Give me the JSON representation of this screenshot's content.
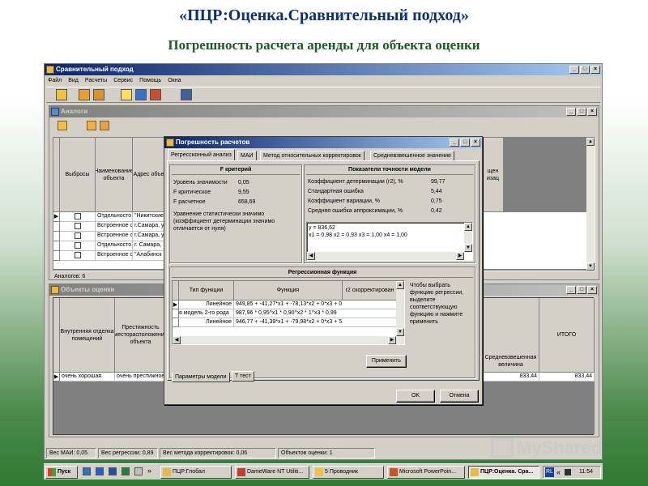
{
  "slide": {
    "title": "«ПЦР:Оценка.Сравнительный подход»",
    "subtitle": "Погрешность расчета аренды для объекта оценки"
  },
  "main_window": {
    "title": "Сравнительный подход",
    "menu": [
      "Файл",
      "Вид",
      "Расчеты",
      "Сервис",
      "Помощь",
      "Окна"
    ]
  },
  "analogs_window": {
    "title": "Аналоги",
    "columns": [
      "Выбросы",
      "Наименование объекта",
      "Адрес объекта"
    ],
    "right_col": "...щен\n...изац",
    "rows": [
      {
        "name": "Отдельносто",
        "addr": "\"Никитские"
      },
      {
        "name": "Встроенное с",
        "addr": "г.Самара, у"
      },
      {
        "name": "Встроенное с",
        "addr": "г.Самара, у"
      },
      {
        "name": "Отдельносто",
        "addr": "г. Самара,"
      },
      {
        "name": "Встроенное с",
        "addr": "\"Алабинск"
      }
    ],
    "status": "Аналогов: 6"
  },
  "objects_window": {
    "title": "Объекты оценки",
    "columns": [
      "Внутренняя отделка помещений",
      "Престижность месторасположения объекта"
    ],
    "right_cols": [
      "Средневзвешенная величина",
      "ИТОГО"
    ],
    "row": {
      "c1": "очень хорошая",
      "c2": "очень престижное",
      "v1": "833,44",
      "v2": "833,44"
    }
  },
  "dialog": {
    "title": "Погрешность расчетов",
    "tabs": [
      "Регрессионный анализ",
      "МАИ",
      "Метод относительных корректировок",
      "Средневзвешенное значение"
    ],
    "f_group": {
      "title": "F критерий",
      "rows": [
        {
          "label": "Уровень значимости",
          "value": "0,05"
        },
        {
          "label": "F критическое",
          "value": "9,55"
        },
        {
          "label": "F расчетное",
          "value": "658,69"
        }
      ],
      "note": "Уравнение статистически значимо (коэффициент детерминации значимо отличается от нуля)"
    },
    "accuracy_group": {
      "title": "Показатели точности модели",
      "rows": [
        {
          "label": "Коэффициент детерминации (r2), %",
          "value": "99,77"
        },
        {
          "label": "Стандартная ошибка",
          "value": "5,44"
        },
        {
          "label": "Коэффициент вариации, %",
          "value": "0,75"
        },
        {
          "label": "Средняя ошибка аппроксимации, %",
          "value": "0,42"
        }
      ],
      "text_line1": "у = 836,62",
      "text_line2": "x1 = 0,98  x2 = 0,93  x3 = 1,00  x4 = 1,00"
    },
    "regression": {
      "title": "Регрессионная функция",
      "columns": [
        "Тип функции",
        "Функция",
        "r2 скорректирован"
      ],
      "rows": [
        {
          "type": "Линейное",
          "func": "949,85 + -41,27*x1 + -78,13*x2 + 0*x3 + 0"
        },
        {
          "type": "я модель 2-го рода",
          "func": "987,96 * 0,95^x1 * 0,90^x2 * 1^x3 * 0,99"
        },
        {
          "type": "Линейное",
          "func": "946,77 + -41,39*x1 + -79,98*x2 + 0*x3 + 5"
        }
      ],
      "hint": "Чтобы выбрать функцию регрессии, выделите соответствующую функцию и нажмите применить",
      "apply": "Применить"
    },
    "bottom_tabs": [
      "Параметры модели",
      "T тест"
    ],
    "ok": "OK",
    "cancel": "Отмена"
  },
  "statusbar": [
    "Вес МАИ: 0,05",
    "Вес регрессии: 0,89",
    "Вес метода корректировок: 0,06",
    "Объектов оценки: 1"
  ],
  "taskbar": {
    "start": "Пуск",
    "items": [
      {
        "label": "ПЦР:Глобал",
        "active": false
      },
      {
        "label": "DameWare NT Utiliti...",
        "active": false
      },
      {
        "label": "5 Проводник",
        "active": false
      },
      {
        "label": "Microsoft PowerPoin...",
        "active": false
      },
      {
        "label": "ПЦР:Оценка. Сра...",
        "active": true
      }
    ],
    "lang": "RL",
    "clock": "11:54"
  },
  "watermark": "MyShared"
}
